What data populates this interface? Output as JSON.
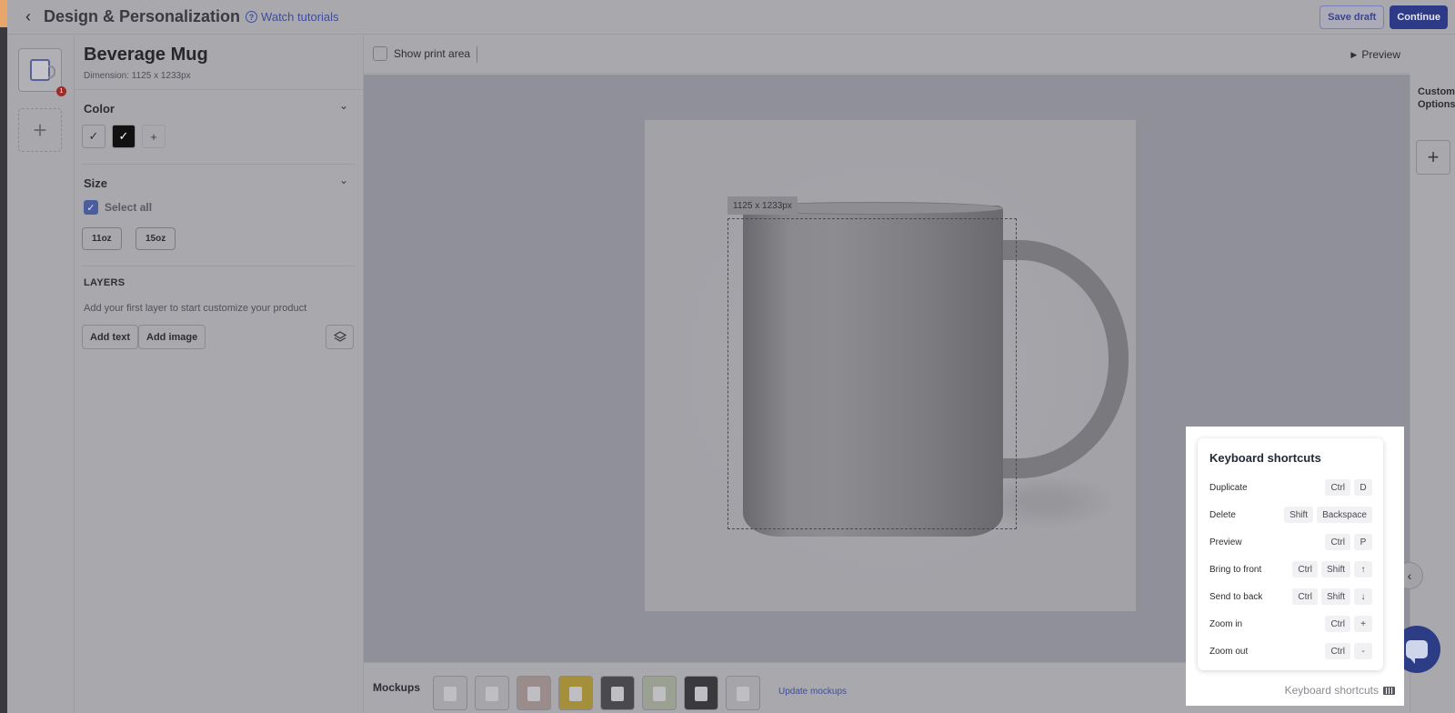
{
  "header": {
    "title": "Design & Personalization",
    "tutorials": "Watch tutorials",
    "save_draft": "Save draft",
    "continue": "Continue"
  },
  "rail": {
    "badge": "1"
  },
  "product": {
    "name": "Beverage Mug",
    "dimension": "Dimension: 1125 x 1233px",
    "color_label": "Color",
    "size_label": "Size",
    "select_all": "Select all",
    "sizes": [
      "11oz",
      "15oz"
    ],
    "layers_label": "LAYERS",
    "layers_hint": "Add your first layer to start customize your product",
    "add_text": "Add text",
    "add_image": "Add image"
  },
  "canvas": {
    "show_print_area": "Show print area",
    "preview": "Preview",
    "print_size": "1125 x 1233px"
  },
  "mockups": {
    "label": "Mockups",
    "update": "Update mockups",
    "thumbs": [
      {
        "bg": "#a6a6aa"
      },
      {
        "bg": "#a6a6aa"
      },
      {
        "bg": "#9a8c8a"
      },
      {
        "bg": "#a58f3a"
      },
      {
        "bg": "#4a4a4e"
      },
      {
        "bg": "#9aa092"
      },
      {
        "bg": "#3a3a3c"
      },
      {
        "bg": "#a6a6aa"
      }
    ]
  },
  "right": {
    "custom_options": "Custom Options"
  },
  "shortcuts": {
    "title": "Keyboard shortcuts",
    "footer": "Keyboard shortcuts",
    "items": [
      {
        "name": "Duplicate",
        "keys": [
          "Ctrl",
          "D"
        ]
      },
      {
        "name": "Delete",
        "keys": [
          "Shift",
          "Backspace"
        ]
      },
      {
        "name": "Preview",
        "keys": [
          "Ctrl",
          "P"
        ]
      },
      {
        "name": "Bring to front",
        "keys": [
          "Ctrl",
          "Shift",
          "↑"
        ]
      },
      {
        "name": "Send to back",
        "keys": [
          "Ctrl",
          "Shift",
          "↓"
        ]
      },
      {
        "name": "Zoom in",
        "keys": [
          "Ctrl",
          "+"
        ]
      },
      {
        "name": "Zoom out",
        "keys": [
          "Ctrl",
          "-"
        ]
      }
    ]
  },
  "colors": {
    "accent": "#2d3a88",
    "link": "#3f4d9a"
  }
}
